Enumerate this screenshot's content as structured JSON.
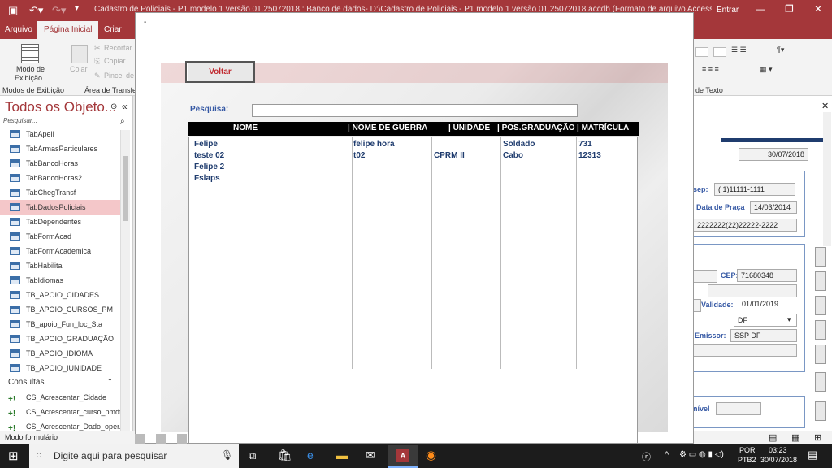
{
  "titlebar": {
    "title": "Cadastro de Policiais - P1 modelo 1 versão 01.25072018 : Banco de dados- D:\\Cadastro de Policiais - P1 modelo 1 versão 01.25072018.accdb (Formato de arquivo Access 2007 - 2016) - Access",
    "signin": "Entrar"
  },
  "menu": {
    "arquivo": "Arquivo",
    "inicial": "Página Inicial",
    "criar": "Criar"
  },
  "ribbon": {
    "modo_line1": "Modo de",
    "modo_line2": "Exibição",
    "colar": "Colar",
    "recortar": "Recortar",
    "copiar": "Copiar",
    "pincel": "Pincel de",
    "group_modos": "Modos de Exibição",
    "group_area": "Área de Transfer",
    "group_texto": "de Texto"
  },
  "nav": {
    "header": "Todos os Objeto...",
    "search_placeholder": "Pesquisar...",
    "items": [
      "TabApelI",
      "TabArmasParticulares",
      "TabBancoHoras",
      "TabBancoHoras2",
      "TabChegTransf",
      "TabDadosPoliciais",
      "TabDependentes",
      "TabFormAcad",
      "TabFormAcademica",
      "TabHabilita",
      "TabIdiomas",
      "TB_APOIO_CIDADES",
      "TB_APOIO_CURSOS_PM",
      "TB_apoio_Fun_loc_Sta",
      "TB_APOIO_GRADUAÇÃO",
      "TB_APOIO_IDIOMA",
      "TB_APOIO_IUNIDADE"
    ],
    "section_consultas": "Consultas",
    "queries": [
      "CS_Acrescentar_Cidade",
      "CS_Acrescentar_curso_pmdf",
      "CS_Acrescentar_Dado_oper..."
    ]
  },
  "status": {
    "text": "Modo formulário"
  },
  "popup": {
    "voltar": "Voltar",
    "dash": "-",
    "pesquisa_label": "Pesquisa:",
    "pesquisa_value": "",
    "columns": [
      "NOME",
      "| NOME DE GUERRA",
      "| UNIDADE",
      "| POS.GRADUAÇÃO",
      "| MATRÍCULA"
    ],
    "rows": [
      {
        "nome": "Felipe",
        "guerra": "felipe hora",
        "unidade": "",
        "grad": "Soldado",
        "mat": "731"
      },
      {
        "nome": "teste 02",
        "guerra": "t02",
        "unidade": "CPRM II",
        "grad": "Cabo",
        "mat": "12313"
      },
      {
        "nome": "Felipe 2",
        "guerra": "",
        "unidade": "",
        "grad": "",
        "mat": ""
      },
      {
        "nome": "Fslaps",
        "guerra": "",
        "unidade": "",
        "grad": "",
        "mat": ""
      }
    ]
  },
  "rightform": {
    "date": "30/07/2018",
    "sep_label": "sep:",
    "sep_value": "( 1)11111-1111",
    "praca_label": "Data de Praça",
    "praca_value": "14/03/2014",
    "phone_value": "2222222(22)22222-2222",
    "cep_label": "CEP:",
    "cep_value": "71680348",
    "validade_label": "Validade:",
    "validade_value": "01/01/2019",
    "uf_value": "DF",
    "emissor_label": "Emissor:",
    "emissor_value": "SSP DF",
    "disp_label": "nível"
  },
  "taskbar": {
    "search_placeholder": "Digite aqui para pesquisar",
    "lang1": "POR",
    "lang2": "PTB2",
    "time": "03:23",
    "date": "30/07/2018"
  }
}
